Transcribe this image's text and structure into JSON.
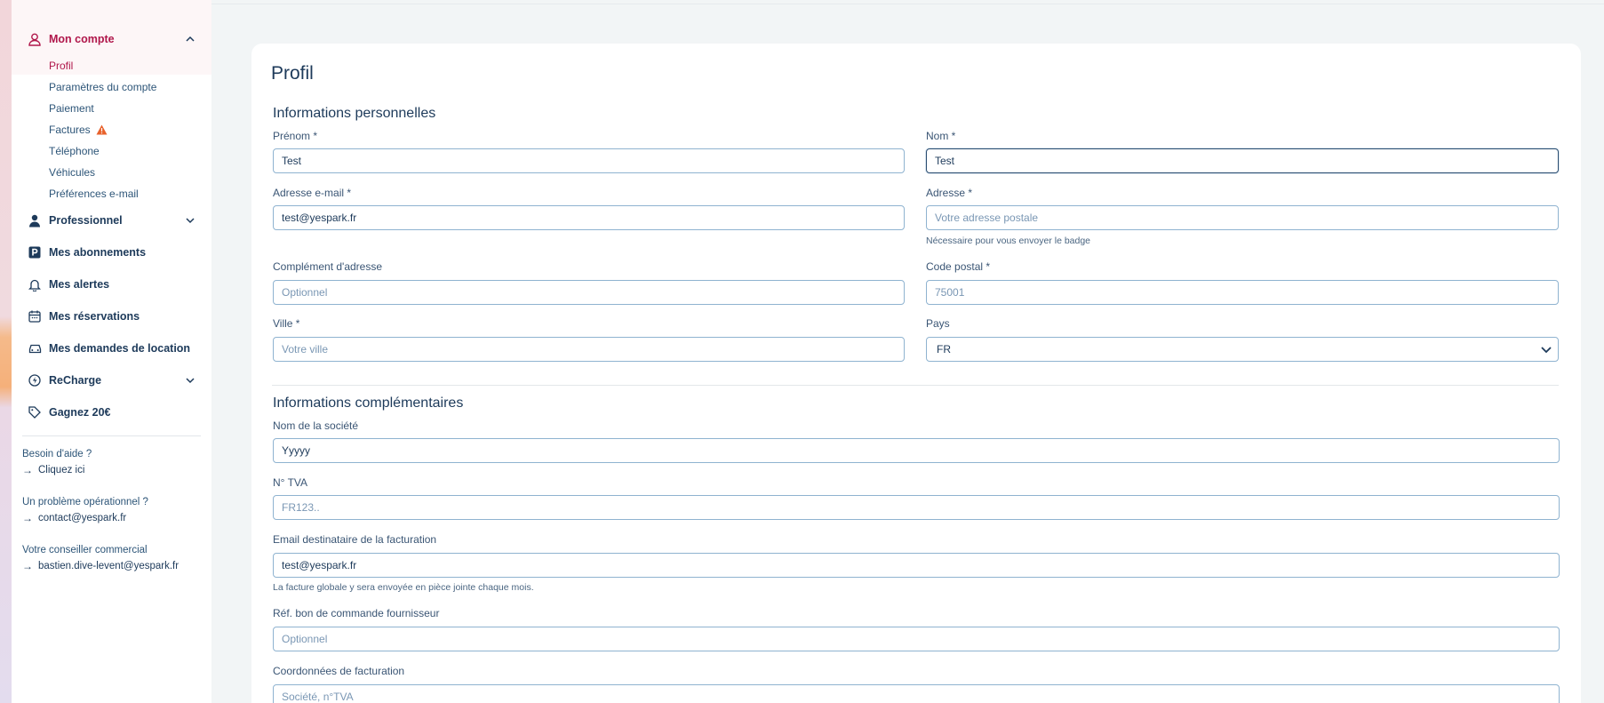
{
  "sidebar": {
    "account": {
      "label": "Mon compte",
      "items": [
        {
          "label": "Profil"
        },
        {
          "label": "Paramètres du compte"
        },
        {
          "label": "Paiement"
        },
        {
          "label": "Factures"
        },
        {
          "label": "Téléphone"
        },
        {
          "label": "Véhicules"
        },
        {
          "label": "Préférences e-mail"
        }
      ]
    },
    "nav": [
      {
        "label": "Professionnel"
      },
      {
        "label": "Mes abonnements"
      },
      {
        "label": "Mes alertes"
      },
      {
        "label": "Mes réservations"
      },
      {
        "label": "Mes demandes de location"
      },
      {
        "label": "ReCharge"
      },
      {
        "label": "Gagnez 20€"
      }
    ],
    "help": [
      {
        "label": "Besoin d'aide ?",
        "link": "Cliquez ici"
      },
      {
        "label": "Un problème opérationnel ?",
        "link": "contact@yespark.fr"
      },
      {
        "label": "Votre conseiller commercial",
        "link": "bastien.dive-levent@yespark.fr"
      }
    ]
  },
  "profile": {
    "title": "Profil",
    "personal": {
      "title": "Informations personnelles",
      "firstname": {
        "label": "Prénom *",
        "value": "Test"
      },
      "lastname": {
        "label": "Nom *",
        "value": "Test"
      },
      "email": {
        "label": "Adresse e-mail *",
        "value": "test@yespark.fr"
      },
      "address": {
        "label": "Adresse *",
        "placeholder": "Votre adresse postale",
        "hint": "Nécessaire pour vous envoyer le badge"
      },
      "address2": {
        "label": "Complément d'adresse",
        "placeholder": "Optionnel"
      },
      "zip": {
        "label": "Code postal *",
        "placeholder": "75001"
      },
      "city": {
        "label": "Ville *",
        "placeholder": "Votre ville"
      },
      "country": {
        "label": "Pays",
        "value": "FR"
      }
    },
    "extra": {
      "title": "Informations complémentaires",
      "company": {
        "label": "Nom de la société",
        "value": "Yyyyy"
      },
      "vat": {
        "label": "N° TVA",
        "placeholder": "FR123.."
      },
      "billing_email": {
        "label": "Email destinataire de la facturation",
        "value": "test@yespark.fr",
        "hint": "La facture globale y sera envoyée en pièce jointe chaque mois."
      },
      "po": {
        "label": "Réf. bon de commande fournisseur",
        "placeholder": "Optionnel"
      },
      "billing_coords": {
        "label": "Coordonnées de facturation",
        "placeholder": "Société, n°TVA"
      }
    }
  },
  "colors": {
    "accent": "#b0174b",
    "text": "#1d3a5a",
    "warning": "#e8622c",
    "border": "#8fb3d0"
  }
}
